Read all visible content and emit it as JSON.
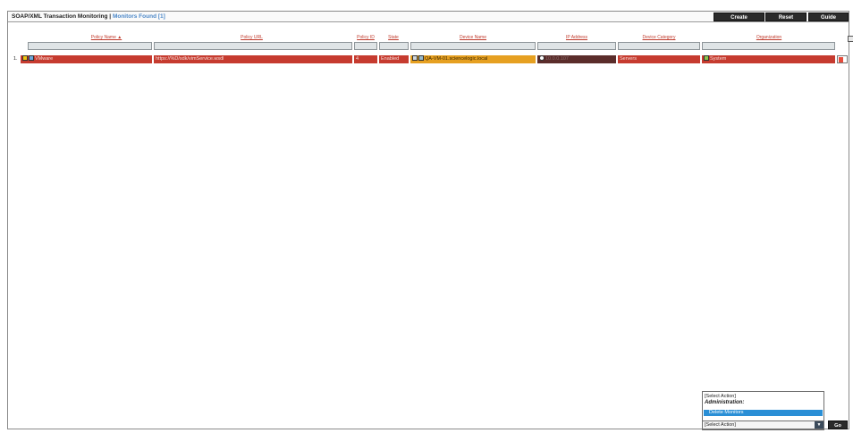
{
  "header": {
    "title": "SOAP/XML Transaction Monitoring |",
    "found": "Monitors Found [1]",
    "buttons": [
      "Create",
      "Reset",
      "Guide"
    ]
  },
  "columns": [
    "Policy Name ▲",
    "Policy URL",
    "Policy ID",
    "State",
    "Device Name",
    "IP Address",
    "Device Category",
    "Organization"
  ],
  "rows": [
    {
      "num": "1.",
      "policy_name": "VMware",
      "policy_url": "https://%D/sdk/vimService.wsdl",
      "policy_id": "4",
      "state": "Enabled",
      "device_name": "QA-VM-01.sciencelogic.local",
      "ip_address": "10.0.0.107",
      "device_category": "Servers",
      "organization": "System"
    }
  ],
  "actions": {
    "items": [
      "[Select Action]",
      "Administration:",
      "Delete Monitors"
    ],
    "selected": "[Select Action]",
    "go": "Go"
  },
  "colors": {
    "row_bg": "#c63b2f",
    "highlight": "#e6a021",
    "header_link": "#c0392b",
    "found": "#4b87c8",
    "selection": "#2a8fd6"
  }
}
